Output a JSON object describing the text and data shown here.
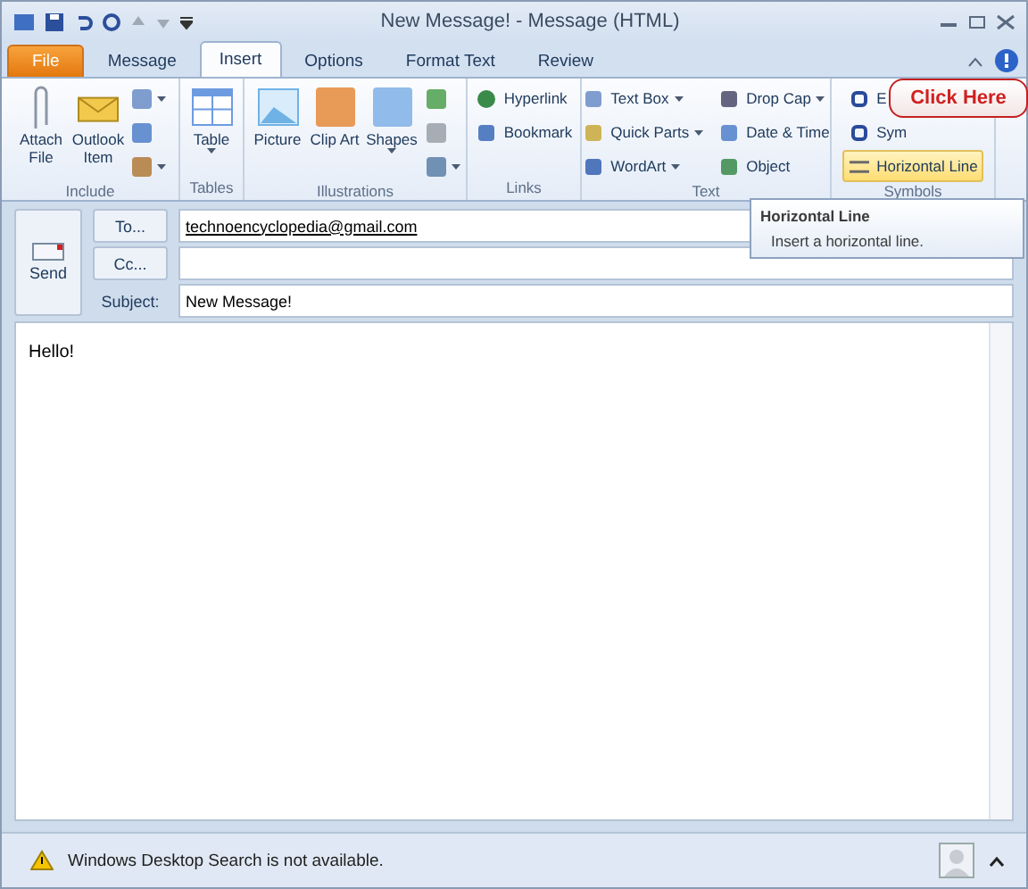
{
  "window": {
    "title": "New Message! - Message (HTML)"
  },
  "tabs": [
    {
      "label": "File",
      "kind": "file",
      "selected": false
    },
    {
      "label": "Message",
      "kind": "tab",
      "selected": false
    },
    {
      "label": "Insert",
      "kind": "tab",
      "selected": true
    },
    {
      "label": "Options",
      "kind": "tab",
      "selected": false
    },
    {
      "label": "Format Text",
      "kind": "tab",
      "selected": false
    },
    {
      "label": "Review",
      "kind": "tab",
      "selected": false
    }
  ],
  "ribbon": [
    {
      "label": "Include",
      "columns": [
        {
          "kind": "large",
          "items": [
            {
              "label": "Attach File",
              "dropdown": false
            }
          ]
        },
        {
          "kind": "large",
          "items": [
            {
              "label": "Outlook Item",
              "dropdown": false
            }
          ]
        },
        {
          "kind": "icons",
          "items": [
            {
              "dropdown": true
            },
            {
              "dropdown": false
            },
            {
              "dropdown": true
            }
          ]
        }
      ]
    },
    {
      "label": "Tables",
      "columns": [
        {
          "kind": "large",
          "items": [
            {
              "label": "Table",
              "dropdown": true
            }
          ]
        }
      ]
    },
    {
      "label": "Illustrations",
      "columns": [
        {
          "kind": "large",
          "items": [
            {
              "label": "Picture",
              "dropdown": false
            }
          ]
        },
        {
          "kind": "large",
          "items": [
            {
              "label": "Clip Art",
              "dropdown": false
            }
          ]
        },
        {
          "kind": "large",
          "items": [
            {
              "label": "Shapes",
              "dropdown": true
            }
          ]
        },
        {
          "kind": "icons",
          "items": [
            {
              "dropdown": false
            },
            {
              "dropdown": false
            },
            {
              "dropdown": true
            }
          ]
        }
      ]
    },
    {
      "label": "Links",
      "columns": [
        {
          "kind": "small",
          "items": [
            {
              "label": "Hyperlink",
              "dropdown": false,
              "highlighted": false
            },
            {
              "label": "Bookmark",
              "dropdown": false,
              "highlighted": false
            }
          ]
        }
      ]
    },
    {
      "label": "Text",
      "columns": [
        {
          "kind": "small",
          "items": [
            {
              "label": "Text Box",
              "dropdown": true,
              "highlighted": false
            },
            {
              "label": "Quick Parts",
              "dropdown": true,
              "highlighted": false
            },
            {
              "label": "WordArt",
              "dropdown": true,
              "highlighted": false
            }
          ]
        },
        {
          "kind": "small",
          "items": [
            {
              "label": "Drop Cap",
              "dropdown": true,
              "highlighted": false
            },
            {
              "label": "Date & Time",
              "dropdown": false,
              "highlighted": false
            },
            {
              "label": "Object",
              "dropdown": false,
              "highlighted": false
            }
          ]
        }
      ]
    },
    {
      "label": "Symbols",
      "columns": [
        {
          "kind": "small",
          "items": [
            {
              "label": "E",
              "dropdown": false,
              "highlighted": false
            },
            {
              "label": "Sym",
              "dropdown": false,
              "highlighted": false
            },
            {
              "label": "Horizontal Line",
              "dropdown": false,
              "highlighted": true
            }
          ]
        }
      ]
    }
  ],
  "callout": {
    "text": "Click Here"
  },
  "tooltip": {
    "title": "Horizontal Line",
    "text": "Insert a horizontal line."
  },
  "header": {
    "send": "Send",
    "fields": [
      {
        "label": "To...",
        "kind": "button",
        "value": "technoencyclopedia@gmail.com"
      },
      {
        "label": "Cc...",
        "kind": "button"
      },
      {
        "label": "Subject:",
        "kind": "label",
        "value": "New Message!"
      }
    ]
  },
  "body": {
    "text": "Hello!"
  },
  "status_bar": {
    "text": "Windows Desktop Search is not available."
  }
}
